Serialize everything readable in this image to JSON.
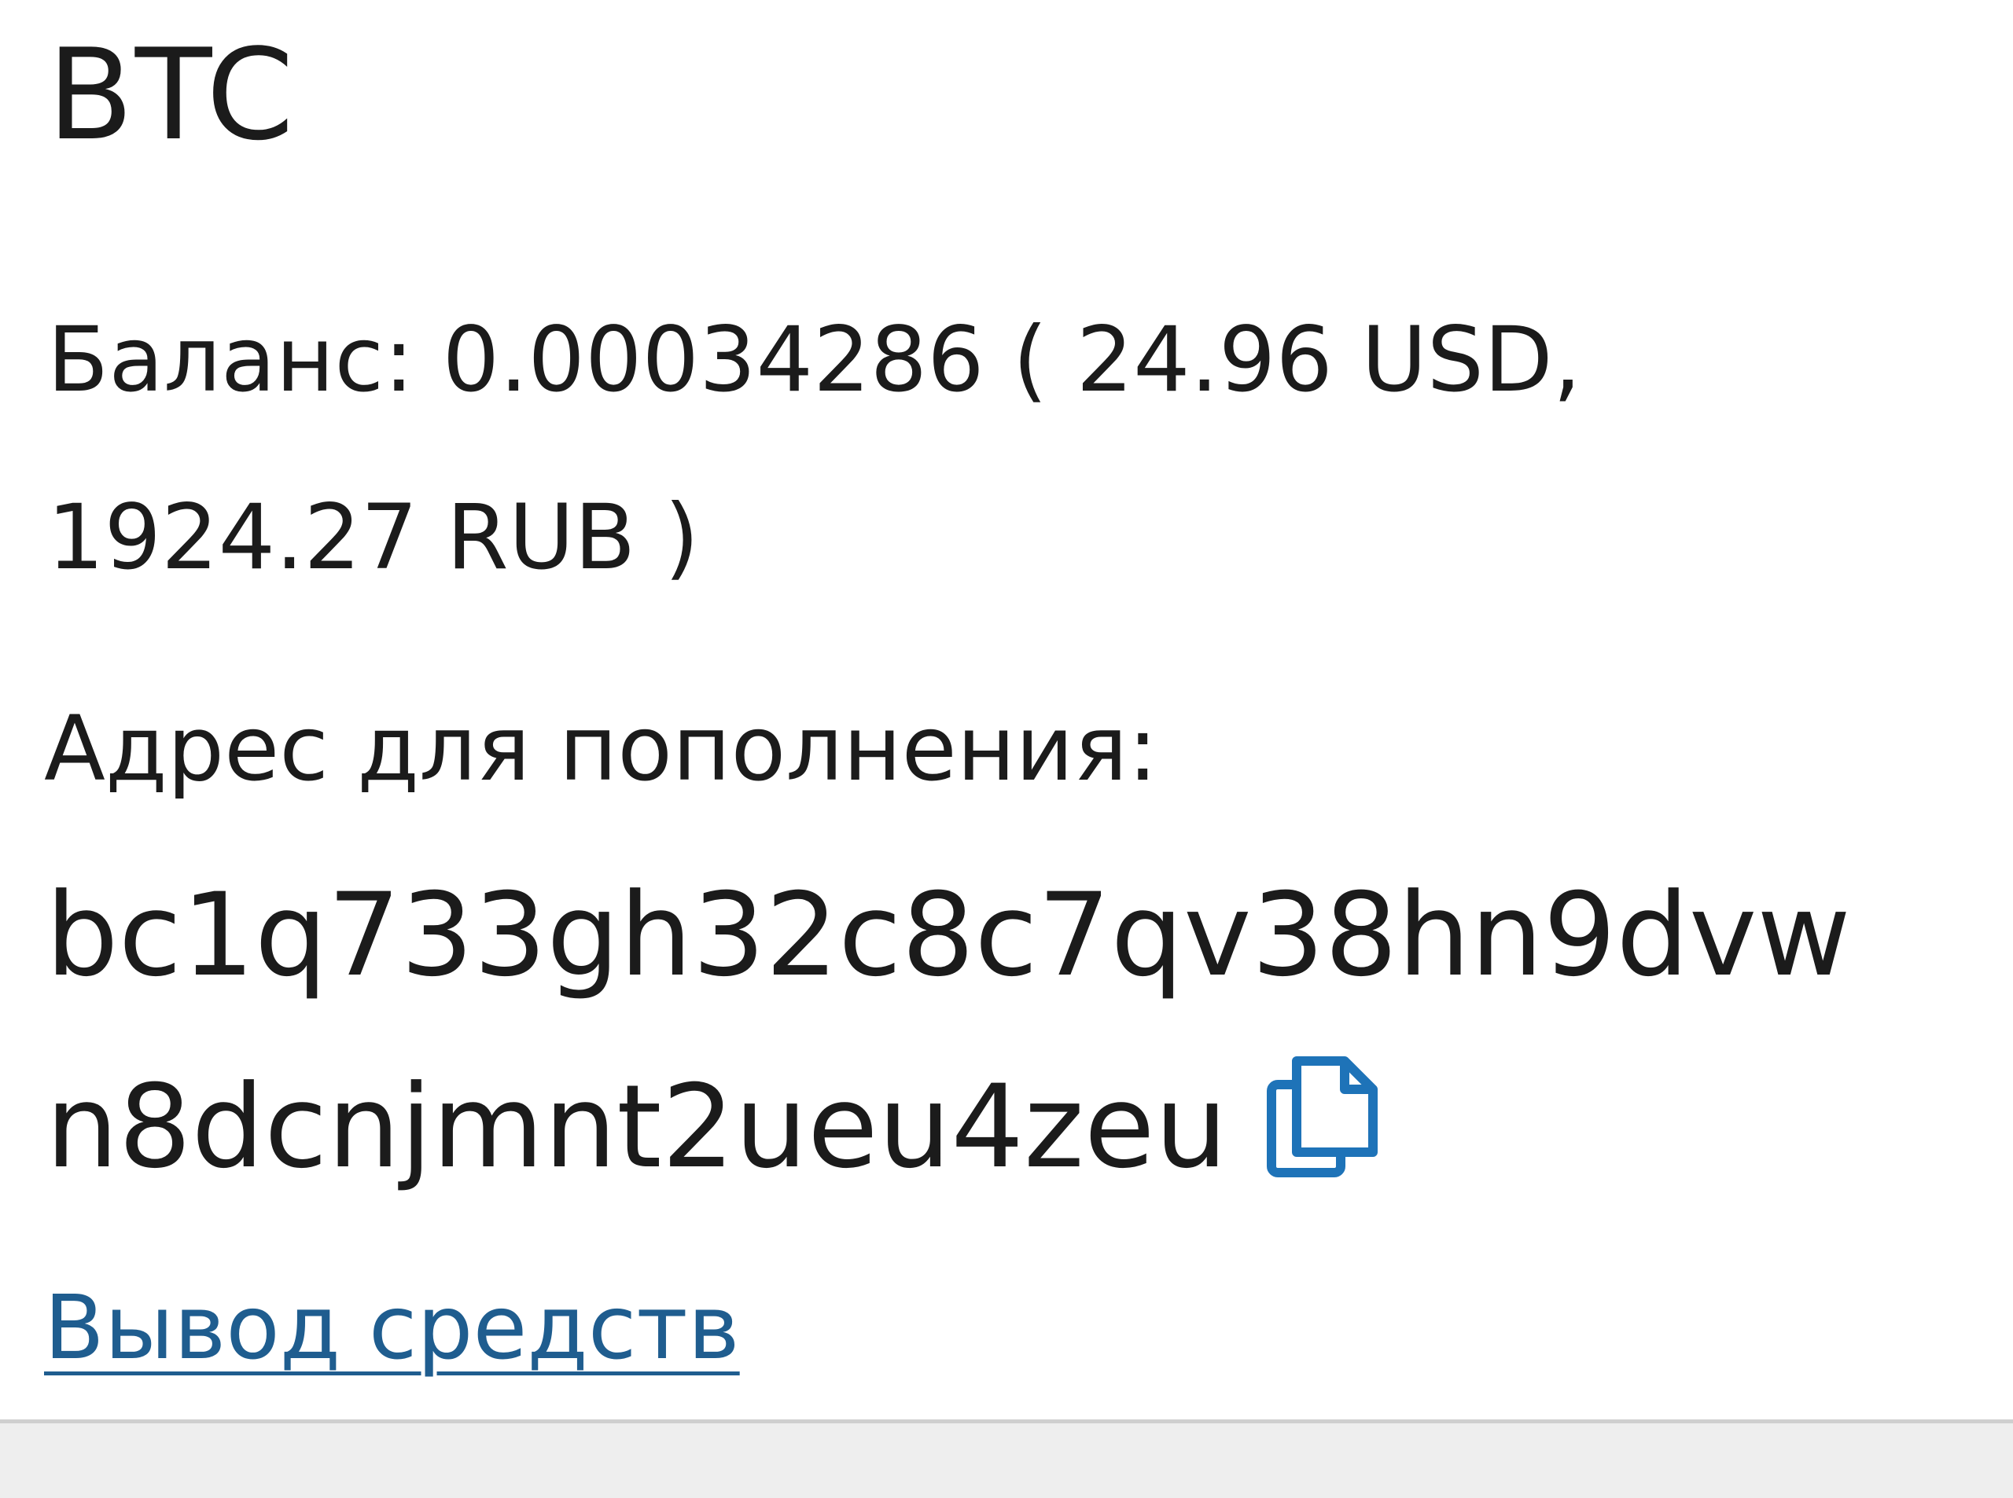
{
  "wallet": {
    "currency": "BTC",
    "balance": {
      "line1": "Баланс: 0.00034286 ( 24.96 USD,",
      "line2": "1924.27 RUB )"
    },
    "deposit": {
      "label": "Адрес для пополнения:",
      "address_line1": "bc1q733gh32c8c7qv38hn9dvw",
      "address_line2": "n8dcnjmnt2ueu4zeu",
      "copy_icon": "copy-icon"
    },
    "withdraw_link": "Вывод средств"
  },
  "colors": {
    "background": "#ffffff",
    "text": "#1b1b1b",
    "link": "#1f5d8f",
    "copy_icon": "#1e73b8",
    "bottom_bar": "#eeeeee",
    "divider": "#cfcfcf"
  }
}
